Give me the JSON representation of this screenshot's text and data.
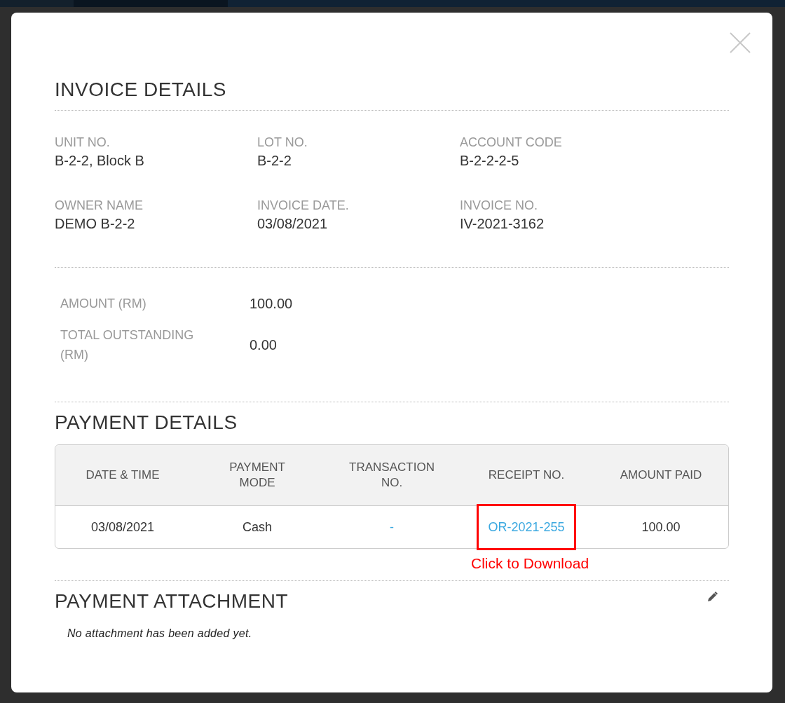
{
  "invoice_details": {
    "title": "INVOICE DETAILS",
    "fields": [
      {
        "label": "UNIT NO.",
        "value": "B-2-2, Block B"
      },
      {
        "label": "LOT NO.",
        "value": "B-2-2"
      },
      {
        "label": "ACCOUNT CODE",
        "value": "B-2-2-2-5"
      },
      {
        "label": "OWNER NAME",
        "value": "DEMO B-2-2"
      },
      {
        "label": "INVOICE DATE.",
        "value": "03/08/2021"
      },
      {
        "label": "INVOICE NO.",
        "value": "IV-2021-3162"
      }
    ]
  },
  "amounts": [
    {
      "label": "AMOUNT (RM)",
      "value": "100.00"
    },
    {
      "label": "TOTAL OUTSTANDING (RM)",
      "value": "0.00"
    }
  ],
  "payment_details": {
    "title": "PAYMENT DETAILS",
    "table": {
      "columns": [
        "DATE & TIME",
        "PAYMENT MODE",
        "TRANSACTION NO.",
        "RECEIPT NO.",
        "AMOUNT PAID"
      ],
      "rows": [
        {
          "cells": [
            {
              "kind": "text",
              "text": "03/08/2021",
              "highlighted": false
            },
            {
              "kind": "text",
              "text": "Cash",
              "highlighted": false
            },
            {
              "kind": "link",
              "text": "-",
              "highlighted": false
            },
            {
              "kind": "link",
              "text": "OR-2021-255",
              "highlighted": true,
              "note": "Click to Download"
            },
            {
              "kind": "text",
              "text": "100.00",
              "highlighted": false
            }
          ]
        }
      ]
    }
  },
  "payment_attachment": {
    "title": "PAYMENT ATTACHMENT",
    "empty_message": "No attachment has been added yet."
  }
}
